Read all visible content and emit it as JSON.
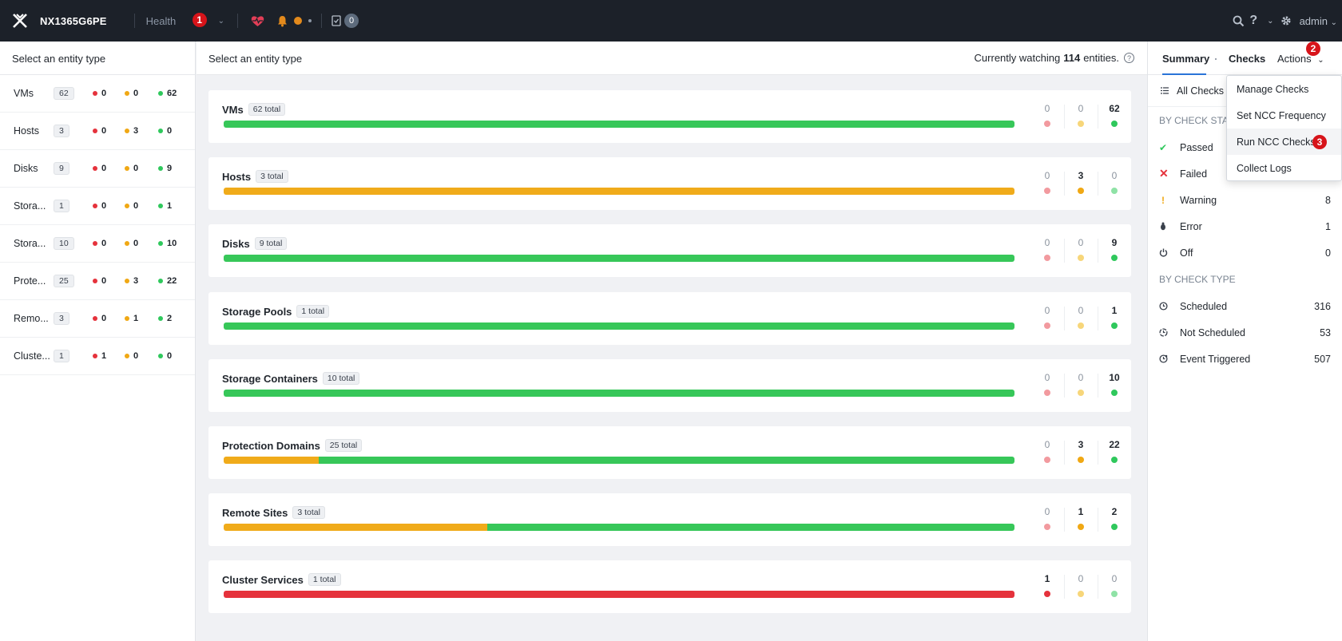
{
  "topbar": {
    "cluster_name": "NX1365G6PE",
    "nav_label": "Health",
    "task_count": "0",
    "user": "admin",
    "icons": [
      "x-logo-icon",
      "chevron-down-icon",
      "heart-pulse-icon",
      "bell-icon",
      "checklist-icon",
      "search-icon",
      "help-icon",
      "gear-icon"
    ]
  },
  "markers": {
    "one": "1",
    "two": "2",
    "three": "3"
  },
  "left_panel": {
    "title": "Select an entity type",
    "rows": [
      {
        "name": "VMs",
        "count": "62",
        "red": "0",
        "yellow": "0",
        "green": "62"
      },
      {
        "name": "Hosts",
        "count": "3",
        "red": "0",
        "yellow": "3",
        "green": "0"
      },
      {
        "name": "Disks",
        "count": "9",
        "red": "0",
        "yellow": "0",
        "green": "9"
      },
      {
        "name": "Stora...",
        "count": "1",
        "red": "0",
        "yellow": "0",
        "green": "1"
      },
      {
        "name": "Stora...",
        "count": "10",
        "red": "0",
        "yellow": "0",
        "green": "10"
      },
      {
        "name": "Prote...",
        "count": "25",
        "red": "0",
        "yellow": "3",
        "green": "22"
      },
      {
        "name": "Remo...",
        "count": "3",
        "red": "0",
        "yellow": "1",
        "green": "2"
      },
      {
        "name": "Cluste...",
        "count": "1",
        "red": "1",
        "yellow": "0",
        "green": "0"
      }
    ]
  },
  "center": {
    "title": "Select an entity type",
    "watch_prefix": "Currently watching",
    "watch_count": "114",
    "watch_suffix": "entities.",
    "cards": [
      {
        "name": "VMs",
        "total": "62 total",
        "red": "0",
        "yellow": "0",
        "green": "62",
        "fraction_red": 0,
        "fraction_yellow": 0,
        "fraction_green": 1
      },
      {
        "name": "Hosts",
        "total": "3 total",
        "red": "0",
        "yellow": "3",
        "green": "0",
        "fraction_red": 0,
        "fraction_yellow": 1,
        "fraction_green": 0
      },
      {
        "name": "Disks",
        "total": "9 total",
        "red": "0",
        "yellow": "0",
        "green": "9",
        "fraction_red": 0,
        "fraction_yellow": 0,
        "fraction_green": 1
      },
      {
        "name": "Storage Pools",
        "total": "1 total",
        "red": "0",
        "yellow": "0",
        "green": "1",
        "fraction_red": 0,
        "fraction_yellow": 0,
        "fraction_green": 1
      },
      {
        "name": "Storage Containers",
        "total": "10 total",
        "red": "0",
        "yellow": "0",
        "green": "10",
        "fraction_red": 0,
        "fraction_yellow": 0,
        "fraction_green": 1
      },
      {
        "name": "Protection Domains",
        "total": "25 total",
        "red": "0",
        "yellow": "3",
        "green": "22",
        "fraction_red": 0,
        "fraction_yellow": 0.12,
        "fraction_green": 0.88
      },
      {
        "name": "Remote Sites",
        "total": "3 total",
        "red": "0",
        "yellow": "1",
        "green": "2",
        "fraction_red": 0,
        "fraction_yellow": 0.3333,
        "fraction_green": 0.6667
      },
      {
        "name": "Cluster Services",
        "total": "1 total",
        "red": "1",
        "yellow": "0",
        "green": "0",
        "fraction_red": 1,
        "fraction_yellow": 0,
        "fraction_green": 0
      }
    ]
  },
  "right_panel": {
    "tabs": {
      "summary": "Summary",
      "checks": "Checks",
      "actions": "Actions"
    },
    "all_checks": "All Checks",
    "section_status": "BY CHECK STATUS",
    "status_rows": [
      {
        "label": "Passed",
        "value": ""
      },
      {
        "label": "Failed",
        "value": ""
      },
      {
        "label": "Warning",
        "value": "8"
      },
      {
        "label": "Error",
        "value": "1"
      },
      {
        "label": "Off",
        "value": "0"
      }
    ],
    "section_type": "BY CHECK TYPE",
    "type_rows": [
      {
        "label": "Scheduled",
        "value": "316"
      },
      {
        "label": "Not Scheduled",
        "value": "53"
      },
      {
        "label": "Event Triggered",
        "value": "507"
      }
    ]
  },
  "dropdown": {
    "items": [
      "Manage Checks",
      "Set NCC Frequency",
      "Run NCC Checks",
      "Collect Logs"
    ]
  },
  "colors": {
    "red": "#e5323c",
    "yellow": "#f0ab1a",
    "green": "#37c759",
    "accent": "#2a74d8",
    "topbar": "#1c2129"
  }
}
